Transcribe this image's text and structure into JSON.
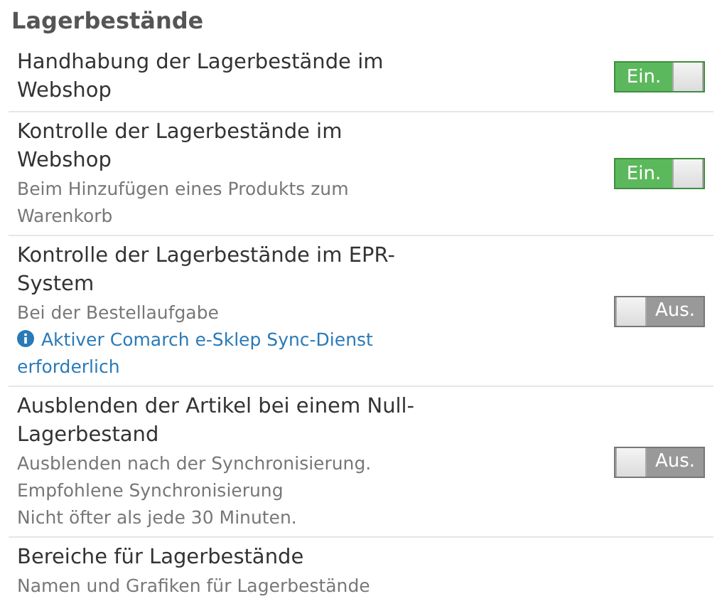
{
  "section": {
    "title": "Lagerbestände"
  },
  "settings": [
    {
      "title": "Handhabung der Lagerbestände im Webshop",
      "toggle": {
        "on": true,
        "label": "Ein."
      }
    },
    {
      "title": "Kontrolle der Lagerbestände im Webshop",
      "description": [
        "Beim Hinzufügen eines Produkts zum Warenkorb"
      ],
      "toggle": {
        "on": true,
        "label": "Ein."
      }
    },
    {
      "title": "Kontrolle der Lagerbestände im EPR-System",
      "description": [
        "Bei der Bestellaufgabe"
      ],
      "info": "Aktiver Comarch e-Sklep Sync-Dienst erforderlich",
      "toggle": {
        "on": false,
        "label": "Aus."
      }
    },
    {
      "title": "Ausblenden der Artikel bei einem Null-Lagerbestand",
      "description": [
        "Ausblenden nach der Synchronisierung.",
        "Empfohlene Synchronisierung",
        "Nicht öfter als jede 30 Minuten."
      ],
      "toggle": {
        "on": false,
        "label": "Aus."
      }
    },
    {
      "title": "Bereiche für Lagerbestände",
      "description": [
        "Namen und Grafiken für Lagerbestände"
      ]
    }
  ]
}
